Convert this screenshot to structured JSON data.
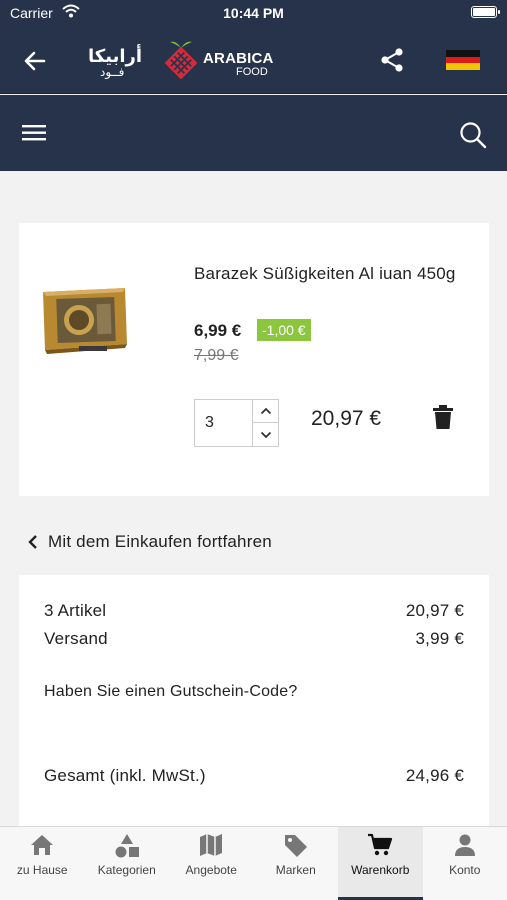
{
  "status_bar": {
    "carrier": "Carrier",
    "time": "10:44 PM"
  },
  "header": {
    "logo_arabic_line1": "أرابيكا",
    "logo_arabic_line2": "فــود",
    "logo_brand": "ARABICA",
    "logo_sub": "FOOD",
    "language_flag": "de"
  },
  "cart_item": {
    "name": "Barazek Süßigkeiten Al iuan 450g",
    "price": "6,99 €",
    "discount": "-1,00 €",
    "old_price": "7,99 €",
    "quantity": "3",
    "line_total": "20,97 €"
  },
  "continue_label": "Mit dem Einkaufen fortfahren",
  "summary": {
    "items_label": "3 Artikel",
    "items_value": "20,97 €",
    "shipping_label": "Versand",
    "shipping_value": "3,99 €",
    "voucher_label": "Haben Sie einen Gutschein-Code?",
    "total_label": "Gesamt (inkl. MwSt.)",
    "total_value": "24,96 €"
  },
  "tabs": [
    {
      "label": "zu Hause",
      "icon": "home-icon"
    },
    {
      "label": "Kategorien",
      "icon": "shapes-icon"
    },
    {
      "label": "Angebote",
      "icon": "map-icon"
    },
    {
      "label": "Marken",
      "icon": "tag-icon"
    },
    {
      "label": "Warenkorb",
      "icon": "cart-icon",
      "active": true
    },
    {
      "label": "Konto",
      "icon": "person-icon"
    }
  ],
  "colors": {
    "nav": "#27334a",
    "discount": "#8cc63f",
    "logo_red": "#d42a3b"
  }
}
